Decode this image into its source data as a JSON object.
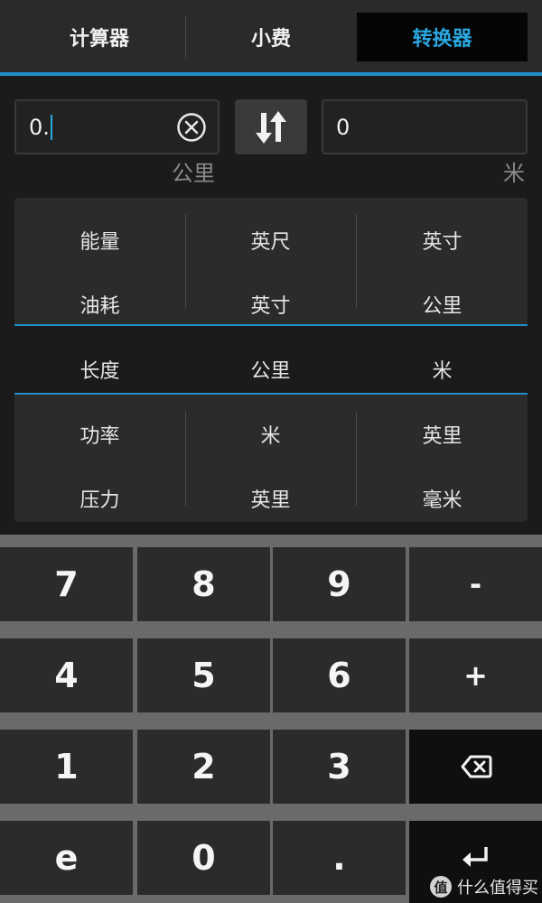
{
  "tabs": [
    {
      "label": "计算器",
      "active": false
    },
    {
      "label": "小费",
      "active": false
    },
    {
      "label": "转换器",
      "active": true
    }
  ],
  "converter": {
    "from_value": "0.",
    "to_value": "0",
    "from_unit": "公里",
    "to_unit": "米"
  },
  "picker": {
    "columns": [
      [
        "能量",
        "油耗",
        "长度",
        "功率",
        "压力"
      ],
      [
        "英尺",
        "英寸",
        "公里",
        "米",
        "英里"
      ],
      [
        "英寸",
        "公里",
        "米",
        "英里",
        "毫米"
      ]
    ],
    "selected_index": 2
  },
  "keypad": {
    "rows": [
      [
        "7",
        "8",
        "9",
        "-"
      ],
      [
        "4",
        "5",
        "6",
        "+"
      ],
      [
        "1",
        "2",
        "3",
        "backspace"
      ],
      [
        "e",
        "0",
        ".",
        "enter"
      ]
    ]
  },
  "watermark": {
    "logo": "值",
    "text": "什么值得买"
  },
  "colors": {
    "accent": "#1e8fc6",
    "active_tab_text": "#2aa6e0",
    "background": "#1b1b1b",
    "key_background": "#2b2b2b"
  }
}
